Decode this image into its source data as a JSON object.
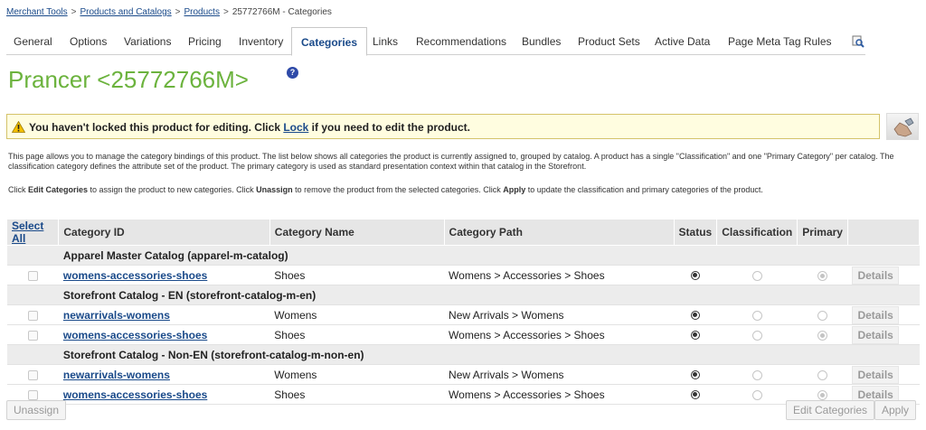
{
  "breadcrumb": {
    "items": [
      "Merchant Tools",
      "Products and Catalogs",
      "Products"
    ],
    "current": "25772766M - Categories",
    "separator": ">"
  },
  "tabs": [
    "General",
    "Options",
    "Variations",
    "Pricing",
    "Inventory",
    "Categories",
    "Links",
    "Recommendations",
    "Bundles",
    "Product Sets",
    "Active Data",
    "Page Meta Tag Rules"
  ],
  "active_tab": "Categories",
  "page_title": "Prancer <25772766M>",
  "help_icon": "?",
  "warning": {
    "before": "You haven't locked this product for editing. Click ",
    "link": "Lock",
    "after": " if you need to edit the product."
  },
  "description1": "This page allows you to manage the category bindings of this product. The list below shows all categories the product is currently assigned to, grouped by catalog. A product has a single \"Classification\" and one \"Primary Category\" per catalog. The classification category defines the attribute set of the product. The primary category is used as standard presentation context within that catalog in the Storefront.",
  "description2": {
    "p1": "Click ",
    "b1": "Edit Categories",
    "p2": " to assign the product to new categories. Click ",
    "b2": "Unassign",
    "p3": " to remove the product from the selected categories. Click ",
    "b3": "Apply",
    "p4": " to update the classification and primary categories of the product."
  },
  "table": {
    "select_all": "Select All",
    "headers": [
      "Category ID",
      "Category Name",
      "Category Path",
      "Status",
      "Classification",
      "Primary"
    ],
    "details_label": "Details",
    "groups": [
      {
        "name": "Apparel Master Catalog (apparel-m-catalog)",
        "rows": [
          {
            "id": "womens-accessories-shoes",
            "name": "Shoes",
            "path": "Womens > Accessories > Shoes",
            "primary": true
          }
        ]
      },
      {
        "name": "Storefront Catalog - EN (storefront-catalog-m-en)",
        "rows": [
          {
            "id": "newarrivals-womens",
            "name": "Womens",
            "path": "New Arrivals > Womens",
            "primary": false
          },
          {
            "id": "womens-accessories-shoes",
            "name": "Shoes",
            "path": "Womens > Accessories > Shoes",
            "primary": true
          }
        ]
      },
      {
        "name": "Storefront Catalog - Non-EN (storefront-catalog-m-non-en)",
        "rows": [
          {
            "id": "newarrivals-womens",
            "name": "Womens",
            "path": "New Arrivals > Womens",
            "primary": false
          },
          {
            "id": "womens-accessories-shoes",
            "name": "Shoes",
            "path": "Womens > Accessories > Shoes",
            "primary": true
          }
        ]
      }
    ]
  },
  "buttons": {
    "unassign": "Unassign",
    "edit_categories": "Edit Categories",
    "apply": "Apply"
  },
  "colors": {
    "title": "#6cb33e",
    "link": "#1a4a8a",
    "warning_bg": "#fffde0"
  }
}
